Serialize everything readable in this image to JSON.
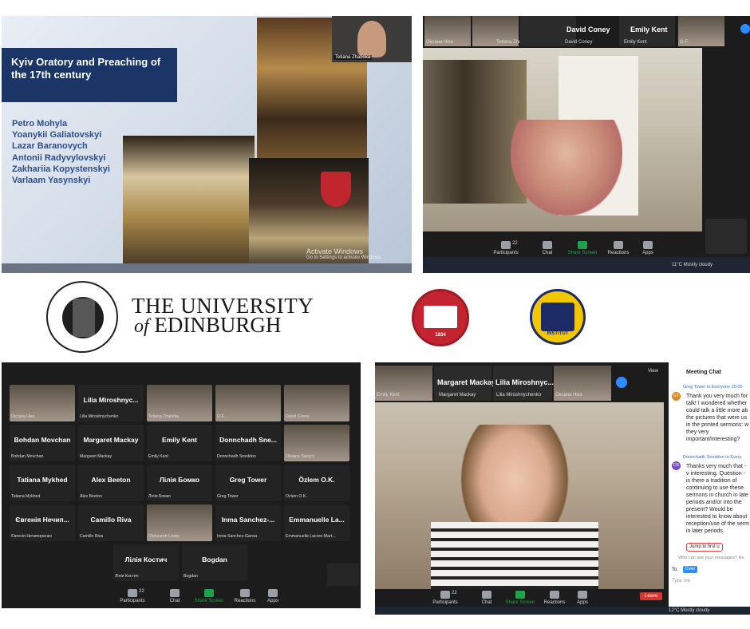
{
  "panel1": {
    "slide_title": "Kyiv Oratory and Preaching of the 17th century",
    "names": [
      "Petro Mohyla",
      "Yoanykii Galiatovskyi",
      "Lazar Baranovych",
      "Antonii Radyvylovskyi",
      "Zakhariia Kopystenskyi",
      "Varlaam Yasynskyi"
    ],
    "cam_label": "Tetiana Zhabska",
    "activate": "Activate Windows",
    "activate_sub": "Go to Settings to activate Windows."
  },
  "panel2": {
    "strip": [
      {
        "label": "Оксана Ніка"
      },
      {
        "label": "Tetiana Zhabska"
      },
      {
        "big": "David Coney",
        "label": "David Coney"
      },
      {
        "big": "Emily Kent",
        "label": "Emily Kent"
      },
      {
        "label": "O.F."
      }
    ],
    "speaker_tag": "kay",
    "toolbar": [
      "Participants",
      "Chat",
      "Share Screen",
      "Reactions",
      "Apps"
    ],
    "participants_count": "22",
    "weather": "11°C  Mostly cloudy"
  },
  "logos": {
    "edinburgh_line1": "THE UNIVERSITY",
    "edinburgh_of": "of",
    "edinburgh_line2": "EDINBURGH",
    "red_year": "1834",
    "yellow_text": "INSTITUT"
  },
  "panel3": {
    "tiles": [
      {
        "name": "",
        "sub": "Оксана Ніка",
        "video": true
      },
      {
        "name": "Lilia Miroshnyc...",
        "sub": "Lilia Miroshnychenko"
      },
      {
        "name": "",
        "sub": "Tetiana Zhabska",
        "video": true
      },
      {
        "name": "",
        "sub": "O.F.",
        "video": true
      },
      {
        "name": "",
        "sub": "David Coney",
        "video": true
      },
      {
        "name": "Bohdan Movchan",
        "sub": "Bohdan Movchan"
      },
      {
        "name": "Margaret Mackay",
        "sub": "Margaret Mackay"
      },
      {
        "name": "Emily Kent",
        "sub": "Emily Kent"
      },
      {
        "name": "Donnchadh Sne...",
        "sub": "Donnchadh Sneddon"
      },
      {
        "name": "",
        "sub": "Oksana Savych",
        "video": true
      },
      {
        "name": "Tatiana Mykhed",
        "sub": "Tatiana Mykhed"
      },
      {
        "name": "Alex Beeton",
        "sub": "Alex Beeton"
      },
      {
        "name": "Лілія Бомко",
        "sub": "Лілія Бомко"
      },
      {
        "name": "Greg Tower",
        "sub": "Greg Tower"
      },
      {
        "name": "Özlem O.K.",
        "sub": "Özlem O.K."
      },
      {
        "name": "Євгенія Нечип...",
        "sub": "Євгенія Нечипоренко"
      },
      {
        "name": "Camillo Riva",
        "sub": "Camillo Riva"
      },
      {
        "name": "",
        "sub": "Oleksandr Lesko",
        "video": true
      },
      {
        "name": "Inma Sanchez-...",
        "sub": "Inma Sanchez-Garcia"
      },
      {
        "name": "Emmanuelle La...",
        "sub": "Emmanuelle Lacore-Mart..."
      },
      {
        "name": "Лілія Костич",
        "sub": "Лілія Костич"
      },
      {
        "name": "Bogdan",
        "sub": "Bogdan"
      }
    ],
    "toolbar": [
      "Participants",
      "Chat",
      "Share Screen",
      "Reactions",
      "Apps"
    ],
    "participants_count": "22"
  },
  "panel4": {
    "strip": [
      {
        "label": "Emily Kent"
      },
      {
        "big": "Margaret Mackay",
        "label": "Margaret Mackay"
      },
      {
        "big": "Lilia Miroshnyc...",
        "label": "Lilia Miroshnychenko"
      },
      {
        "label": "Оксана Ніка"
      }
    ],
    "view_label": "View",
    "toolbar": [
      "Participants",
      "Chat",
      "Share Screen",
      "Reactions",
      "Apps"
    ],
    "participants_count": "22",
    "leave": "Leave",
    "weather": "12°C  Mostly cloudy",
    "chat": {
      "title": "Meeting Chat",
      "msg1_from": "Greg Tower to Everyone 20:05",
      "msg1_initials": "GT",
      "msg1_text": "Thank you very much for talk! I wondered whether could talk a little more ab the pictures that were us in the printed sermons: w they very important/interesting?",
      "msg2_from": "Donnchadh Sneddon to Every",
      "msg2_initials": "DS",
      "msg2_text": "Thanks very much that - v interesting. Question - is there a tradition of continuing to use these sermons in church in late periods and/or into the present? Would be interested to know about reception/use of the serm in later periods.",
      "jump": "Jump to first u",
      "who_can_see": "Who can see your messages? Re",
      "to_label": "To:",
      "to_value": "Ever",
      "type_placeholder": "Type me"
    }
  }
}
